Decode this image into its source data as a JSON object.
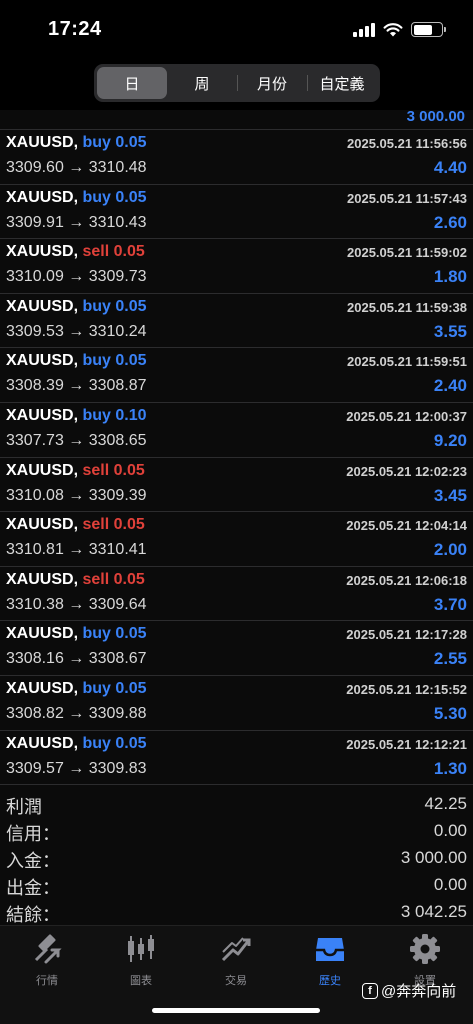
{
  "status_bar": {
    "time": "17:24"
  },
  "period_tabs": [
    {
      "label": "日",
      "active": true
    },
    {
      "label": "周",
      "active": false
    },
    {
      "label": "月份",
      "active": false
    },
    {
      "label": "自定義",
      "active": false
    }
  ],
  "top_amount": "3 000.00",
  "trades": [
    {
      "symbol": "XAUUSD,",
      "side": "buy",
      "volume": "buy 0.05",
      "time": "2025.05.21 11:56:56",
      "prices": "3309.60 → 3310.48",
      "profit": "4.40"
    },
    {
      "symbol": "XAUUSD,",
      "side": "buy",
      "volume": "buy 0.05",
      "time": "2025.05.21 11:57:43",
      "prices": "3309.91 → 3310.43",
      "profit": "2.60"
    },
    {
      "symbol": "XAUUSD,",
      "side": "sell",
      "volume": "sell 0.05",
      "time": "2025.05.21 11:59:02",
      "prices": "3310.09 → 3309.73",
      "profit": "1.80"
    },
    {
      "symbol": "XAUUSD,",
      "side": "buy",
      "volume": "buy 0.05",
      "time": "2025.05.21 11:59:38",
      "prices": "3309.53 → 3310.24",
      "profit": "3.55"
    },
    {
      "symbol": "XAUUSD,",
      "side": "buy",
      "volume": "buy 0.05",
      "time": "2025.05.21 11:59:51",
      "prices": "3308.39 → 3308.87",
      "profit": "2.40"
    },
    {
      "symbol": "XAUUSD,",
      "side": "buy",
      "volume": "buy 0.10",
      "time": "2025.05.21 12:00:37",
      "prices": "3307.73 → 3308.65",
      "profit": "9.20"
    },
    {
      "symbol": "XAUUSD,",
      "side": "sell",
      "volume": "sell 0.05",
      "time": "2025.05.21 12:02:23",
      "prices": "3310.08 → 3309.39",
      "profit": "3.45"
    },
    {
      "symbol": "XAUUSD,",
      "side": "sell",
      "volume": "sell 0.05",
      "time": "2025.05.21 12:04:14",
      "prices": "3310.81 → 3310.41",
      "profit": "2.00"
    },
    {
      "symbol": "XAUUSD,",
      "side": "sell",
      "volume": "sell 0.05",
      "time": "2025.05.21 12:06:18",
      "prices": "3310.38 → 3309.64",
      "profit": "3.70"
    },
    {
      "symbol": "XAUUSD,",
      "side": "buy",
      "volume": "buy 0.05",
      "time": "2025.05.21 12:17:28",
      "prices": "3308.16 → 3308.67",
      "profit": "2.55"
    },
    {
      "symbol": "XAUUSD,",
      "side": "buy",
      "volume": "buy 0.05",
      "time": "2025.05.21 12:15:52",
      "prices": "3308.82 → 3309.88",
      "profit": "5.30"
    },
    {
      "symbol": "XAUUSD,",
      "side": "buy",
      "volume": "buy 0.05",
      "time": "2025.05.21 12:12:21",
      "prices": "3309.57 → 3309.83",
      "profit": "1.30"
    }
  ],
  "summary": [
    {
      "label": "利潤",
      "value": "42.25"
    },
    {
      "label": "信用：",
      "value": "0.00"
    },
    {
      "label": "入金：",
      "value": "3 000.00"
    },
    {
      "label": "出金：",
      "value": "0.00"
    },
    {
      "label": "結餘：",
      "value": "3 042.25"
    }
  ],
  "bottom_tabs": [
    {
      "label": "行情",
      "icon": "quotes-icon",
      "active": false
    },
    {
      "label": "圖表",
      "icon": "chart-icon",
      "active": false
    },
    {
      "label": "交易",
      "icon": "trade-icon",
      "active": false
    },
    {
      "label": "歷史",
      "icon": "history-icon",
      "active": true
    },
    {
      "label": "設置",
      "icon": "gear-icon",
      "active": false
    }
  ],
  "watermark": {
    "badge": "f",
    "text": "@奔奔向前"
  },
  "colors": {
    "buy": "#3a82f7",
    "sell": "#e0413a",
    "profit": "#3a82f7",
    "active_tab": "#3a82f7"
  }
}
